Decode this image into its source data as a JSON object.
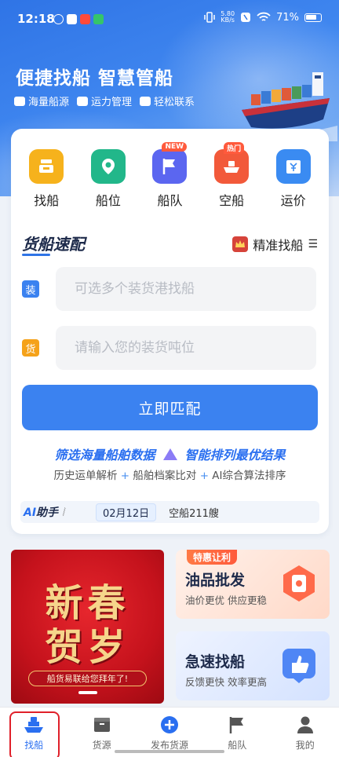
{
  "status_bar": {
    "time": "12:18",
    "net_speed_value": "5.80",
    "net_speed_unit": "KB/s",
    "battery": "71%"
  },
  "hero": {
    "title": "便捷找船 智慧管船",
    "tags": [
      "海量船源",
      "运力管理",
      "轻松联系"
    ]
  },
  "services": [
    {
      "label": "找船",
      "icon": "anchor-icon",
      "color": "#f6b21c",
      "badge": ""
    },
    {
      "label": "船位",
      "icon": "location-icon",
      "color": "#22b78a",
      "badge": ""
    },
    {
      "label": "船队",
      "icon": "flag-icon",
      "color": "#5b66f0",
      "badge": "NEW"
    },
    {
      "label": "空船",
      "icon": "empty-ship-icon",
      "color": "#f2593a",
      "badge": "热门"
    },
    {
      "label": "运价",
      "icon": "calendar-price-icon",
      "color": "#3a8bf2",
      "badge": ""
    }
  ],
  "match": {
    "title": "货船速配",
    "precise_label": "精准找船",
    "load_tag": "装",
    "load_placeholder": "可选多个装货港找船",
    "cargo_tag": "货",
    "cargo_placeholder": "请输入您的装货吨位",
    "button_label": "立即匹配",
    "feature_left": "筛选海量船舶数据",
    "feature_right": "智能排列最优结果",
    "sub_items": [
      "历史运单解析",
      "船舶档案比对",
      "AI综合算法排序"
    ],
    "plus": "+"
  },
  "ai_bar": {
    "ai_prefix": "AI",
    "ai_label": "助手",
    "date": "02月12日",
    "info": "空船211艘"
  },
  "banner": {
    "line1": "新春",
    "line2": "贺岁",
    "caption": "船货易联给您拜年了!"
  },
  "promos": [
    {
      "pill": "特惠让利",
      "title": "油品批发",
      "subtitle": "油价更优 供应更稳",
      "bg": "#ffe6dc"
    },
    {
      "pill": "",
      "title": "急速找船",
      "subtitle": "反馈更快 效率更高",
      "bg": "#dfe9ff"
    }
  ],
  "tabs": [
    {
      "label": "找船",
      "icon": "ship-icon",
      "active": true
    },
    {
      "label": "货源",
      "icon": "box-icon",
      "active": false
    },
    {
      "label": "发布货源",
      "icon": "plus-circle-icon",
      "active": false
    },
    {
      "label": "船队",
      "icon": "flag-icon",
      "active": false
    },
    {
      "label": "我的",
      "icon": "person-icon",
      "active": false
    }
  ]
}
